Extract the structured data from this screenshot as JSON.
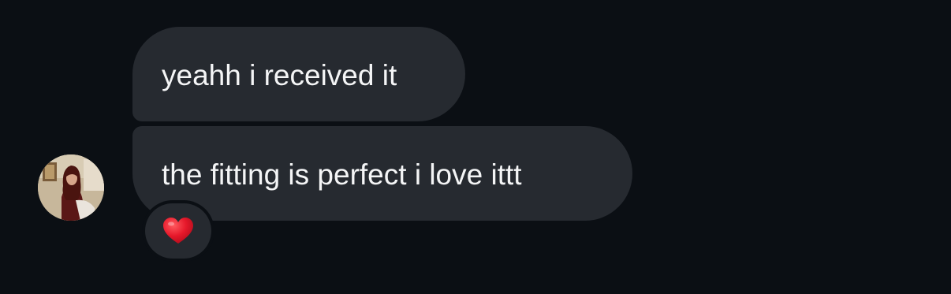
{
  "conversation": {
    "messages": [
      {
        "sender": "other",
        "text": "yeahh i received it"
      },
      {
        "sender": "other",
        "text": "the fitting is perfect i love ittt",
        "reaction": "heart-icon"
      }
    ]
  },
  "colors": {
    "background": "#0b0f14",
    "bubble": "#262a30",
    "text": "#f4f5f6",
    "reaction_heart": "#e6182a"
  }
}
